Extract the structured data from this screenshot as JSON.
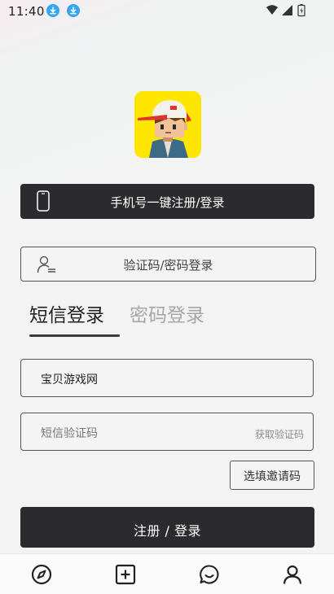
{
  "status_bar": {
    "time": "11:40",
    "left_icons": [
      "download-icon",
      "download-icon"
    ],
    "right_icons": [
      "wifi-icon",
      "signal-icon",
      "battery-icon"
    ],
    "accent_color": "#35a6f0"
  },
  "app": {
    "logo_icon": "pixel-boy-cap-logo",
    "logo_bg_color": "#ffe600"
  },
  "phone_login": {
    "label": "手机号一键注册/登录",
    "icon": "phone-icon"
  },
  "code_pwd_login": {
    "label": "验证码/密码登录",
    "icon": "user-icon"
  },
  "tabs": [
    {
      "label": "短信登录",
      "active": true
    },
    {
      "label": "密码登录",
      "active": false
    }
  ],
  "form": {
    "phone_value": "宝贝游戏网",
    "code_placeholder": "短信验证码",
    "get_code_label": "获取验证码",
    "invite_label": "选填邀请码",
    "submit_label": "注册 / 登录"
  },
  "bottom_nav": [
    {
      "name": "discover",
      "icon": "compass-icon"
    },
    {
      "name": "add",
      "icon": "plus-square-icon"
    },
    {
      "name": "messages",
      "icon": "chat-icon"
    },
    {
      "name": "profile",
      "icon": "person-icon"
    }
  ]
}
